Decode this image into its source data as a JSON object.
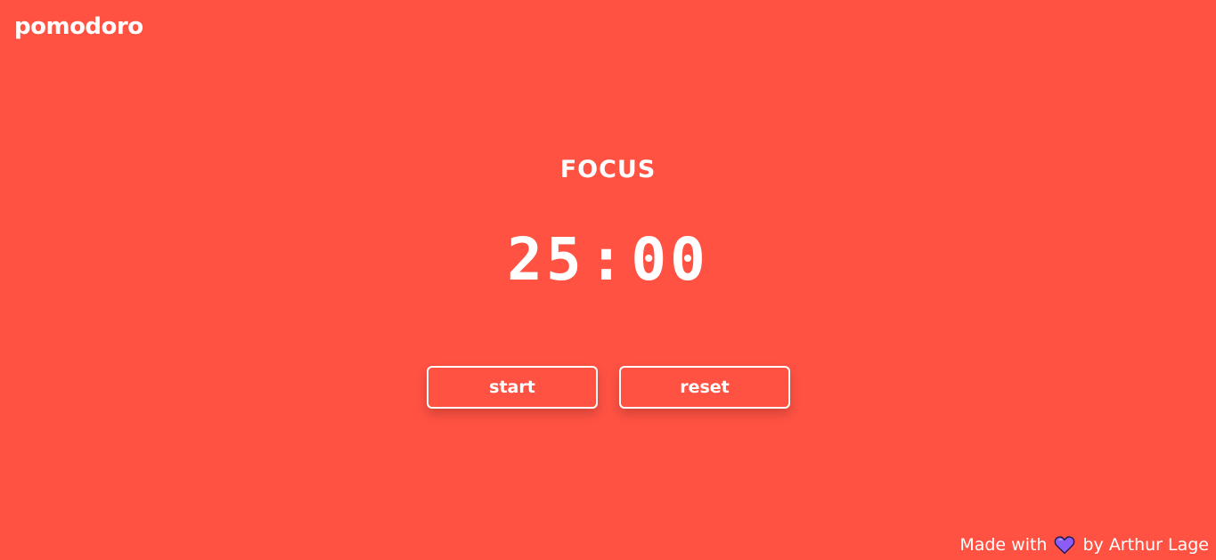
{
  "app": {
    "brand": "pomodoro"
  },
  "timer": {
    "mode_label": "FOCUS",
    "minutes": "25",
    "separator": ":",
    "seconds": "00"
  },
  "controls": {
    "start_label": "start",
    "reset_label": "reset"
  },
  "footer": {
    "prefix": "Made with",
    "icon": "heart-icon",
    "suffix": "by Arthur Lage"
  },
  "colors": {
    "background": "#ff5243",
    "text": "#ffffff",
    "heart": "#8b5cf6"
  }
}
